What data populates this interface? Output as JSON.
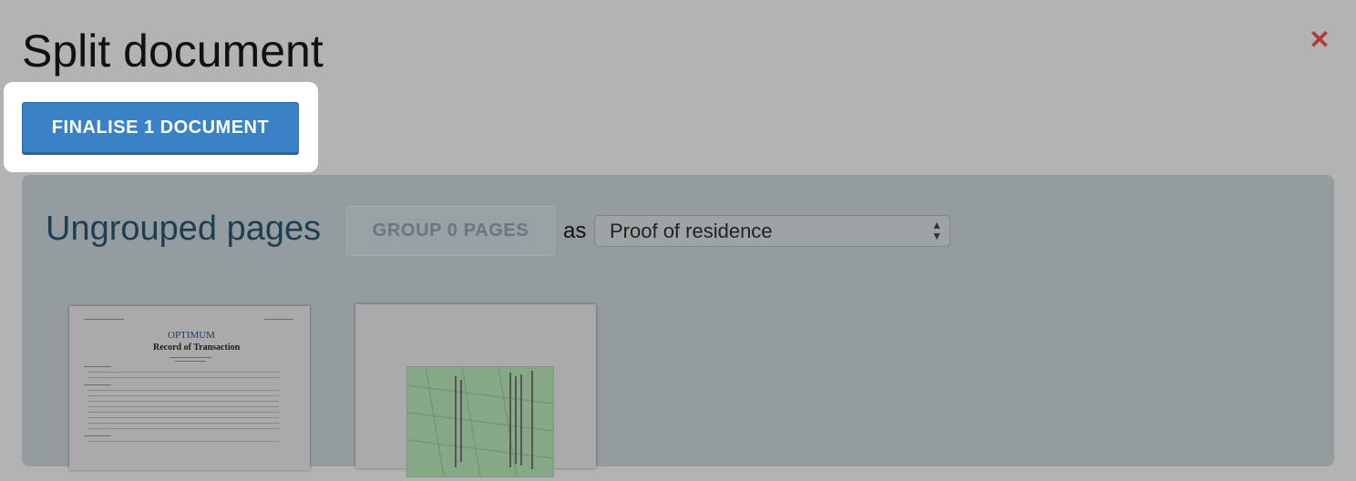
{
  "dialog": {
    "title": "Split document",
    "close_icon": "close-icon",
    "finalise_label": "FINALISE 1 DOCUMENT"
  },
  "ungrouped": {
    "title": "Ungrouped pages",
    "group_button_label": "GROUP 0 PAGES",
    "as_label": "as",
    "document_type_selected": "Proof of residence"
  },
  "thumbnails": [
    {
      "kind": "document-page",
      "logo_text": "OPTIMUM",
      "heading": "Record of Transaction"
    },
    {
      "kind": "id-card-scan"
    }
  ],
  "colors": {
    "accent": "#3a82c5",
    "close": "#b03a3a"
  }
}
